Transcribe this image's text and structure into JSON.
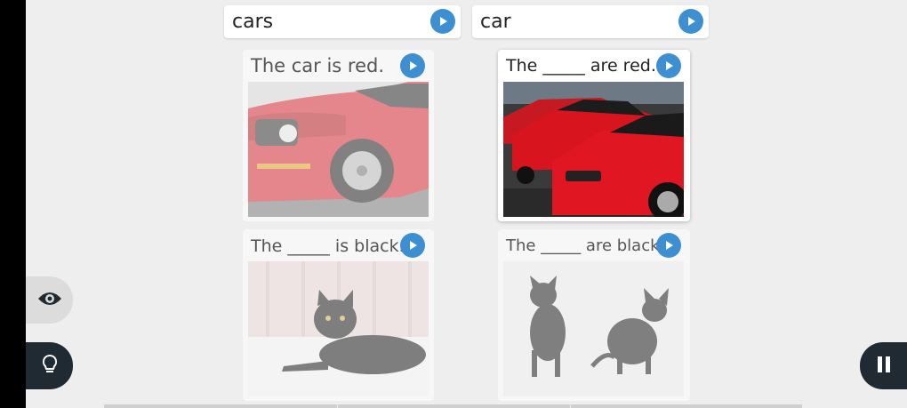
{
  "word_options": [
    {
      "label": "cars"
    },
    {
      "label": "car"
    }
  ],
  "cards": [
    {
      "caption": "The car is red.",
      "image": "red-car-closeup"
    },
    {
      "caption": "The _____ are red.",
      "image": "red-cars-row"
    },
    {
      "caption": "The _____ is black.",
      "image": "black-cat-lying"
    },
    {
      "caption": "The _____ are black.",
      "image": "two-black-cats"
    }
  ],
  "controls": {
    "reveal": "eye-icon",
    "hint": "lightbulb-icon",
    "pause": "pause-icon"
  },
  "colors": {
    "play_button": "#3d8fd1",
    "dark_button": "#1f2a33",
    "background": "#eeeeee"
  }
}
